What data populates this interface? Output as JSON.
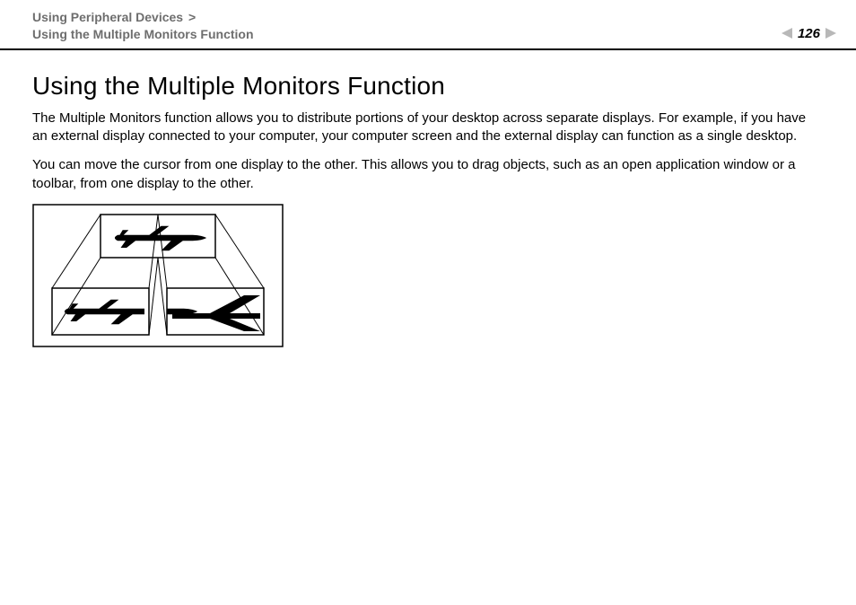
{
  "header": {
    "breadcrumb_line1": "Using Peripheral Devices",
    "breadcrumb_sep": ">",
    "breadcrumb_line2": "Using the Multiple Monitors Function",
    "page_number": "126"
  },
  "main": {
    "title": "Using the Multiple Monitors Function",
    "para1": "The Multiple Monitors function allows you to distribute portions of your desktop across separate displays. For example, if you have an external display connected to your computer, your computer screen and the external display can function as a single desktop.",
    "para2": "You can move the cursor from one display to the other. This allows you to drag objects, such as an open application window or a toolbar, from one display to the other."
  },
  "figure": {
    "description": "multiple-monitors-airplane-diagram"
  }
}
